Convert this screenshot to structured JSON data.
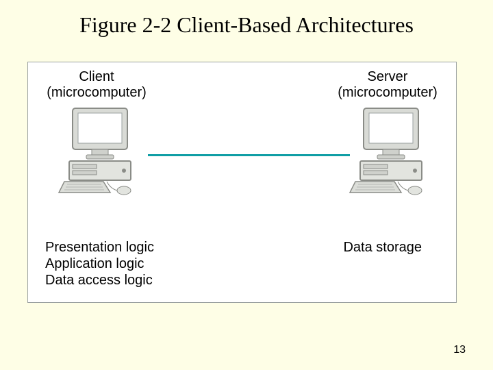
{
  "title": "Figure 2-2 Client-Based Architectures",
  "client": {
    "label_line1": "Client",
    "label_line2": "(microcomputer)",
    "logic": [
      "Presentation logic",
      "Application logic",
      "Data access logic"
    ]
  },
  "server": {
    "label_line1": "Server",
    "label_line2": "(microcomputer)",
    "logic": [
      "Data storage"
    ]
  },
  "page_number": "13"
}
